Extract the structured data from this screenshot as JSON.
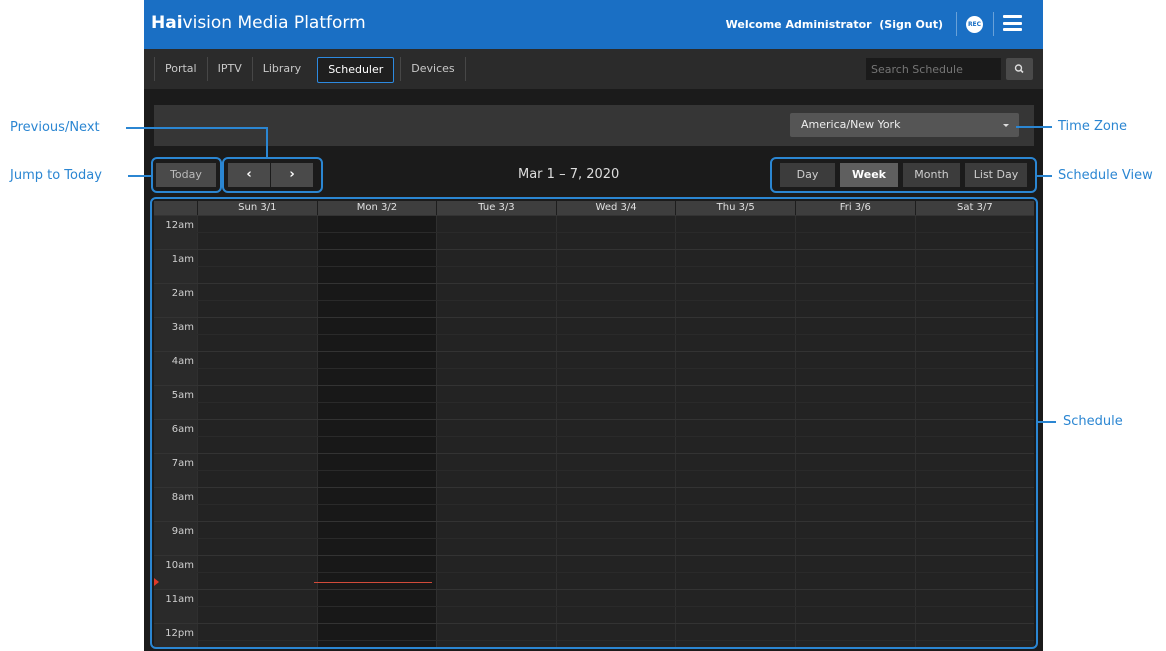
{
  "header": {
    "brand_bold": "Hai",
    "brand_rest": "vision Media Platform",
    "welcome": "Welcome Administrator",
    "sign_out": "(Sign Out)",
    "rec_badge": "REC"
  },
  "nav": {
    "tabs": [
      "Portal",
      "IPTV",
      "Library",
      "Scheduler",
      "Devices"
    ],
    "active_tab": "Scheduler",
    "search_placeholder": "Search Schedule"
  },
  "timezone": {
    "selected": "America/New York"
  },
  "toolbar": {
    "today_label": "Today",
    "prev_glyph": "‹",
    "next_glyph": "›",
    "date_range": "Mar 1 – 7, 2020",
    "views": [
      "Day",
      "Week",
      "Month",
      "List Day"
    ],
    "active_view": "Week"
  },
  "schedule": {
    "days": [
      "Sun 3/1",
      "Mon 3/2",
      "Tue 3/3",
      "Wed 3/4",
      "Thu 3/5",
      "Fri 3/6",
      "Sat 3/7"
    ],
    "today_index": 1,
    "hours": [
      "12am",
      "1am",
      "2am",
      "3am",
      "4am",
      "5am",
      "6am",
      "7am",
      "8am",
      "9am",
      "10am",
      "11am",
      "12pm"
    ]
  },
  "annotations": {
    "previous_next": "Previous/Next",
    "jump_to_today": "Jump to Today",
    "time_zone": "Time Zone",
    "schedule_view": "Schedule View",
    "schedule": "Schedule"
  },
  "colors": {
    "brand_blue": "#1a6fc4",
    "annotation_blue": "#2b86d2",
    "current_time": "#d14b3a"
  }
}
